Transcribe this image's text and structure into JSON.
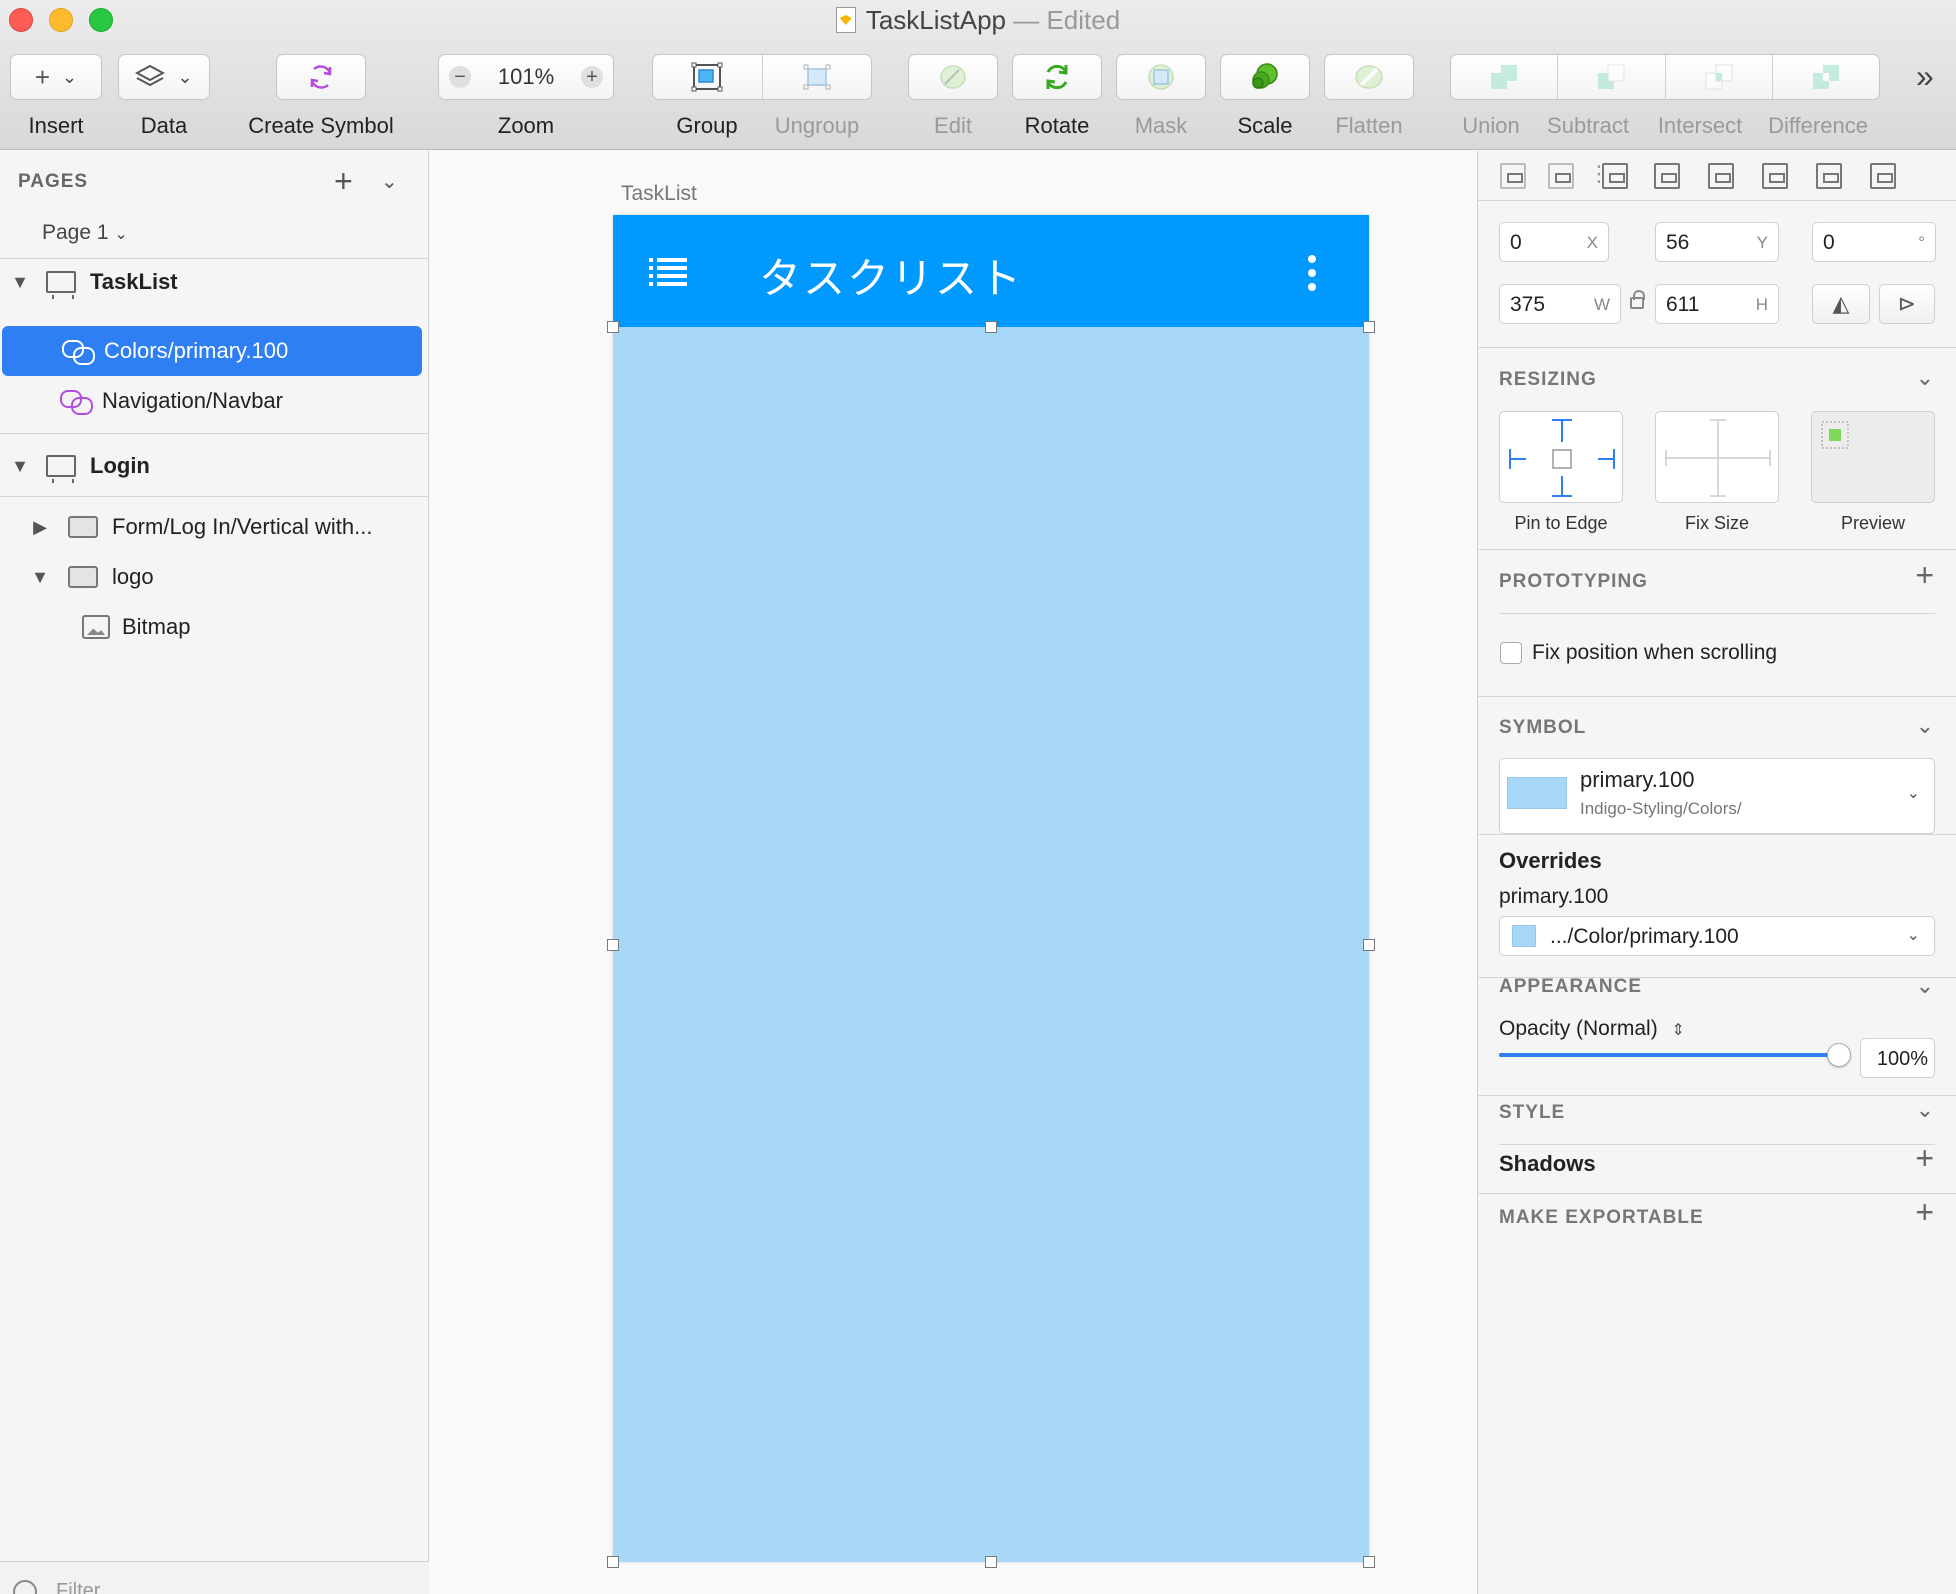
{
  "window": {
    "doc_name": "TaskListApp",
    "status": "— Edited"
  },
  "toolbar": {
    "insert": "Insert",
    "data": "Data",
    "create_symbol": "Create Symbol",
    "zoom_label": "Zoom",
    "zoom_value": "101%",
    "group": "Group",
    "ungroup": "Ungroup",
    "edit": "Edit",
    "rotate": "Rotate",
    "mask": "Mask",
    "scale": "Scale",
    "flatten": "Flatten",
    "union": "Union",
    "subtract": "Subtract",
    "intersect": "Intersect",
    "difference": "Difference",
    "overflow": "»"
  },
  "layers": {
    "pages_header": "PAGES",
    "current_page": "Page 1",
    "items": [
      {
        "label": "TaskList"
      },
      {
        "label": "Colors/primary.100"
      },
      {
        "label": "Navigation/Navbar"
      },
      {
        "label": "Login"
      },
      {
        "label": "Form/Log In/Vertical with..."
      },
      {
        "label": "logo"
      },
      {
        "label": "Bitmap"
      }
    ],
    "filter_placeholder": "Filter"
  },
  "canvas": {
    "artboard_name": "TaskList",
    "navbar_title": "タスクリスト",
    "navbar_color": "#0099ff",
    "fill_color": "#a8d8f8"
  },
  "inspector": {
    "x": "0",
    "x_suffix": "X",
    "y": "56",
    "y_suffix": "Y",
    "rotation": "0",
    "rotation_suffix": "°",
    "w": "375",
    "w_suffix": "W",
    "h": "611",
    "h_suffix": "H",
    "resizing": "RESIZING",
    "pin_to_edge": "Pin to Edge",
    "fix_size": "Fix Size",
    "preview": "Preview",
    "prototyping": "PROTOTYPING",
    "fix_position": "Fix position when scrolling",
    "symbol": "SYMBOL",
    "symbol_name": "primary.100",
    "symbol_path": "Indigo-Styling/Colors/",
    "overrides": "Overrides",
    "override_label": "primary.100",
    "override_value": ".../Color/primary.100",
    "appearance": "APPEARANCE",
    "opacity_label": "Opacity (Normal)",
    "opacity_value": "100%",
    "opacity_fraction": 1.0,
    "style": "STYLE",
    "shadows": "Shadows",
    "make_exportable": "MAKE EXPORTABLE"
  }
}
